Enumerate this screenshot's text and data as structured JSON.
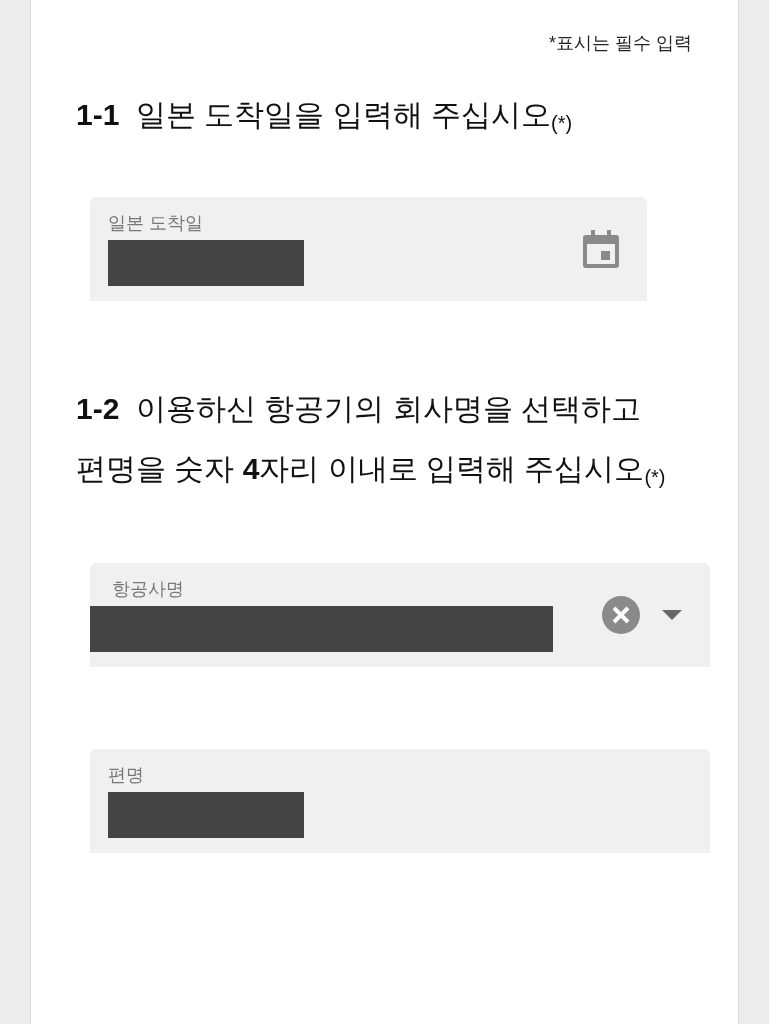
{
  "required_note": "*표시는 필수 입력",
  "questions": [
    {
      "heading": "**1-1**  일본 도착일을 입력해 주십시오$_{(*)}$",
      "fields": [
        {
          "label": "일본 도착일",
          "value_redacted": true,
          "kind": "date"
        }
      ]
    },
    {
      "heading": "**1-2**  이용하신 항공기의 회사명을 선택하고 편명을 숫자 **4**자리 이내로 입력해 주십시오$_{(*)}$",
      "fields": [
        {
          "label": "항공사명",
          "value_redacted": true,
          "kind": "select"
        },
        {
          "label": "편명",
          "value_redacted": true,
          "kind": "text"
        }
      ]
    }
  ]
}
